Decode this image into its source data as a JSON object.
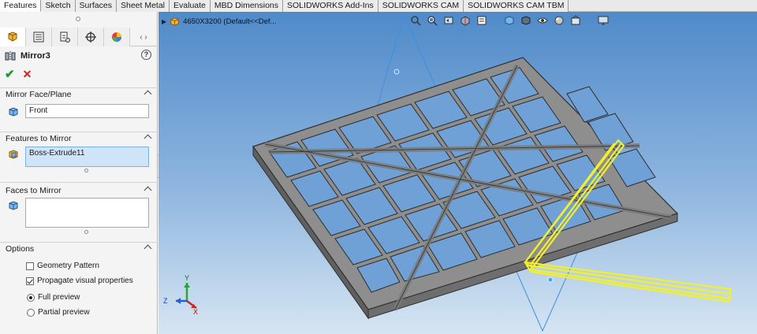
{
  "tabs": [
    "Features",
    "Sketch",
    "Surfaces",
    "Sheet Metal",
    "Evaluate",
    "MBD Dimensions",
    "SOLIDWORKS Add-Ins",
    "SOLIDWORKS CAM",
    "SOLIDWORKS CAM TBM"
  ],
  "active_tab": "Features",
  "panel": {
    "title": "Mirror3",
    "help_glyph": "?",
    "ok_glyph": "✔",
    "cancel_glyph": "✕",
    "sections": {
      "mirror_face": {
        "label": "Mirror Face/Plane",
        "value": "Front"
      },
      "features": {
        "label": "Features to Mirror",
        "value": "Boss-Extrude11"
      },
      "faces": {
        "label": "Faces to Mirror",
        "value": ""
      },
      "options": {
        "label": "Options",
        "geometry_pattern": "Geometry Pattern",
        "geometry_pattern_checked": false,
        "propagate": "Propagate visual properties",
        "propagate_checked": true,
        "full_preview": "Full preview",
        "partial_preview": "Partial preview",
        "preview_selected": "Full preview"
      }
    }
  },
  "viewport": {
    "tree_label": "4650X3200  (Default<<Def...",
    "tree_arrow": "▶",
    "colors": {
      "frame": "#8e8e8e",
      "frame_edge": "#2e2e2e",
      "highlight": "#f3f02a",
      "plane": "#3d8fe0"
    },
    "triad": {
      "x": "X",
      "y": "Y",
      "z": "Z"
    }
  }
}
